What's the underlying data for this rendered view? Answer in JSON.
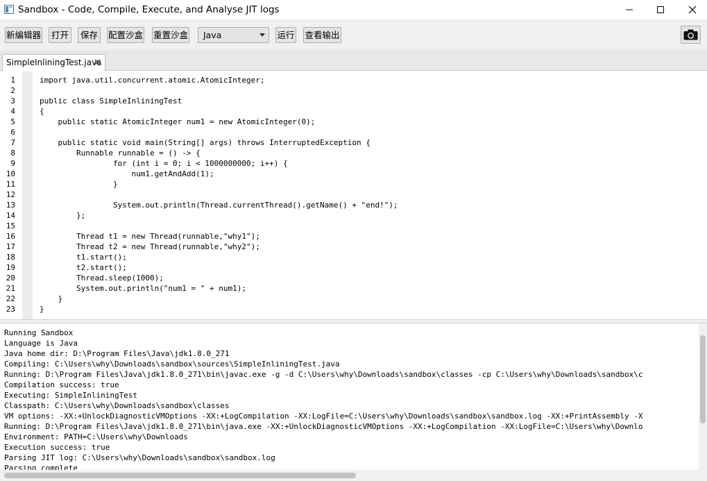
{
  "window": {
    "title": "Sandbox - Code, Compile, Execute, and Analyse JIT logs"
  },
  "toolbar": {
    "new_editor": "新编辑器",
    "open": "打开",
    "save": "保存",
    "configure_sandbox": "配置沙盒",
    "reset_sandbox": "重置沙盒",
    "language": "Java",
    "run": "运行",
    "view_output": "查看输出",
    "camera_icon": "camera-icon"
  },
  "tabs": [
    {
      "label": "SimpleInliningTest.java",
      "close": "✕"
    }
  ],
  "editor": {
    "line_numbers": [
      "1",
      "2",
      "3",
      "4",
      "5",
      "6",
      "7",
      "8",
      "9",
      "10",
      "11",
      "12",
      "13",
      "14",
      "15",
      "16",
      "17",
      "18",
      "19",
      "20",
      "21",
      "22",
      "23"
    ],
    "lines": [
      "import java.util.concurrent.atomic.AtomicInteger;",
      "",
      "public class SimpleInliningTest",
      "{",
      "    public static AtomicInteger num1 = new AtomicInteger(0);",
      "",
      "    public static void main(String[] args) throws InterruptedException {",
      "        Runnable runnable = () -> {",
      "                for (int i = 0; i < 1000000000; i++) {",
      "                    num1.getAndAdd(1);",
      "                }",
      "",
      "                System.out.println(Thread.currentThread().getName() + \"end!\");",
      "        };",
      "",
      "        Thread t1 = new Thread(runnable,\"why1\");",
      "        Thread t2 = new Thread(runnable,\"why2\");",
      "        t1.start();",
      "        t2.start();",
      "        Thread.sleep(1000);",
      "        System.out.println(\"num1 = \" + num1);",
      "    }",
      "}"
    ]
  },
  "console": {
    "lines": [
      "Running Sandbox",
      "Language is Java",
      "Java home dir: D:\\Program Files\\Java\\jdk1.8.0_271",
      "Compiling: C:\\Users\\why\\Downloads\\sandbox\\sources\\SimpleInliningTest.java",
      "Running: D:\\Program Files\\Java\\jdk1.8.0_271\\bin\\javac.exe -g -d C:\\Users\\why\\Downloads\\sandbox\\classes -cp C:\\Users\\why\\Downloads\\sandbox\\c",
      "Compilation success: true",
      "Executing: SimpleInliningTest",
      "Classpath: C:\\Users\\why\\Downloads\\sandbox\\classes",
      "VM options: -XX:+UnlockDiagnosticVMOptions -XX:+LogCompilation -XX:LogFile=C:\\Users\\why\\Downloads\\sandbox\\sandbox.log -XX:+PrintAssembly -X",
      "Running: D:\\Program Files\\Java\\jdk1.8.0_271\\bin\\java.exe -XX:+UnlockDiagnosticVMOptions -XX:+LogCompilation -XX:LogFile=C:\\Users\\why\\Downlo",
      "Environment: PATH=C:\\Users\\why\\Downloads",
      "Execution success: true",
      "Parsing JIT log: C:\\Users\\why\\Downloads\\sandbox\\sandbox.log",
      "Parsing complete"
    ]
  }
}
